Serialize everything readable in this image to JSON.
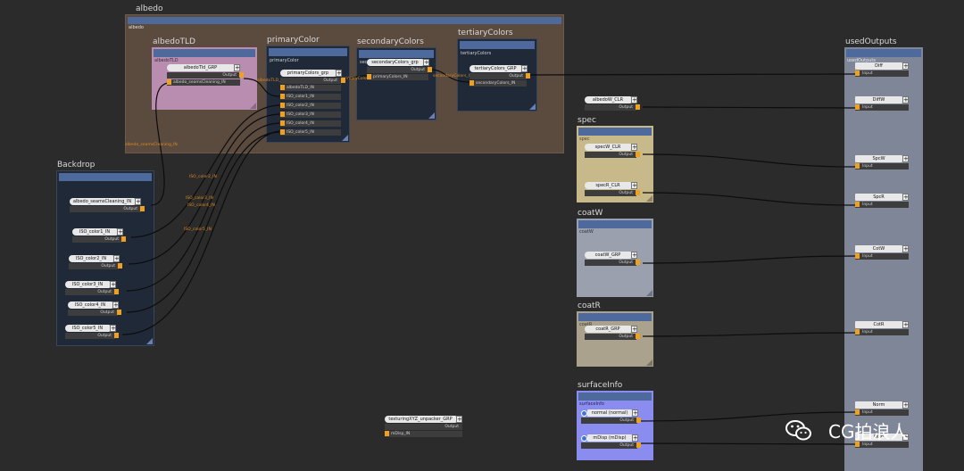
{
  "graph": {
    "backdrops": {
      "albedo": {
        "title": "albedo",
        "label": "albedo"
      },
      "albedoTLD": {
        "title": "albedoTLD",
        "label": "albedoTLD"
      },
      "primaryColor": {
        "title": "primaryColor",
        "label": "primaryColor"
      },
      "secondaryColors": {
        "title": "secondaryColors",
        "label": "sec"
      },
      "tertiaryColors": {
        "title": "tertiaryColors",
        "label": "tertiaryColors"
      },
      "backdrop": {
        "title": "Backdrop"
      },
      "spec": {
        "title": "spec",
        "label": "spec"
      },
      "coatW": {
        "title": "coatW",
        "label": "coatW"
      },
      "coatR": {
        "title": "coatR",
        "label": "coatR"
      },
      "surfaceInfo": {
        "title": "surfaceInfo",
        "label": "surfaceInfo"
      },
      "usedOutputs": {
        "title": "usedOutputs",
        "label": "usedOutputs"
      }
    },
    "nodes": {
      "albedoTLD_GRP": {
        "name": "albedoTld_GRP",
        "out": "Output",
        "in1": "albedo_seamsCleaning_IN"
      },
      "primaryColors_grp": {
        "name": "primaryColors_grp",
        "out": "Output",
        "inputs": [
          "albedoTLD_IN",
          "ISO_color1_IN",
          "ISO_color2_IN",
          "ISO_color3_IN",
          "ISO_color4_IN",
          "ISO_color5_IN"
        ]
      },
      "secondaryColors_grp": {
        "name": "secondaryColors_grp",
        "out": "Output",
        "in1": "primaryColors_IN"
      },
      "tertiaryColors_GRP": {
        "name": "tertiaryColors_GRP",
        "out": "Output",
        "in1": "secondaryColors_IN"
      },
      "albedo_seamsCleaning_IN": {
        "name": "albedo_seamsCleaning_IN",
        "out": "Output"
      },
      "ISO_color1_IN": {
        "name": "ISO_color1_IN",
        "out": "Output"
      },
      "ISO_color2_IN": {
        "name": "ISO_color2_IN",
        "out": "Output"
      },
      "ISO_color3_IN": {
        "name": "ISO_color3_IN",
        "out": "Output"
      },
      "ISO_color4_IN": {
        "name": "ISO_color4_IN",
        "out": "Output"
      },
      "ISO_color5_IN": {
        "name": "ISO_color5_IN",
        "out": "Output"
      },
      "albedoW_CLR": {
        "name": "albedoW_CLR",
        "out": "Output"
      },
      "specW_CLR": {
        "name": "specW_CLR",
        "out": "Output"
      },
      "specR_CLR": {
        "name": "specR_CLR",
        "out": "Output"
      },
      "coatW_GRP": {
        "name": "coatW_GRP",
        "out": "Output"
      },
      "coatR_GRP": {
        "name": "coatR_GRP",
        "out": "Output"
      },
      "normal": {
        "name": "normal (normal)",
        "out": "Output"
      },
      "mDisp": {
        "name": "mDisp (mDisp)",
        "out": "Output"
      },
      "texturing": {
        "name": "texturingXYZ_unpacker_GRP",
        "out": "Output",
        "in1": "mDisp_IN"
      },
      "Diff": {
        "name": "Diff",
        "in": "Input"
      },
      "DiffW": {
        "name": "DiffW",
        "in": "Input"
      },
      "SpcW": {
        "name": "SpcW",
        "in": "Input"
      },
      "SpcR": {
        "name": "SpcR",
        "in": "Input"
      },
      "CotW": {
        "name": "CotW",
        "in": "Input"
      },
      "CotR": {
        "name": "CotR",
        "in": "Input"
      },
      "Norm": {
        "name": "Norm",
        "in": "Input"
      },
      "Disp": {
        "name": "Disp",
        "in": "Input"
      }
    },
    "wire_labels": {
      "w1": "albedo_seamsCleaning_IN",
      "w2": "ISO_color2_IN",
      "w3": "ISO_color3_IN",
      "w4": "ISO_color4_IN",
      "w5": "ISO_color5_IN",
      "w6": "albedoTLD_IN",
      "w7": "primaryColors_IN",
      "w8": "secondaryColors_IN"
    }
  },
  "watermark": {
    "text": "CG拍浪人"
  },
  "colors": {
    "background": "#2b2b2b",
    "albedo_backdrop": "#5b4a3e",
    "albedoTLD_backdrop": "#b98db0",
    "dark_backdrop": "#1f2937",
    "spec_backdrop": "#c8b98a",
    "coat_backdrop": "#9aa0ad",
    "coatR_backdrop": "#aaa28c",
    "surfaceInfo_backdrop": "#8a8cf0",
    "usedOutputs_backdrop": "#7e8698",
    "port": "#f0a020",
    "header": "#4e6a9c"
  }
}
